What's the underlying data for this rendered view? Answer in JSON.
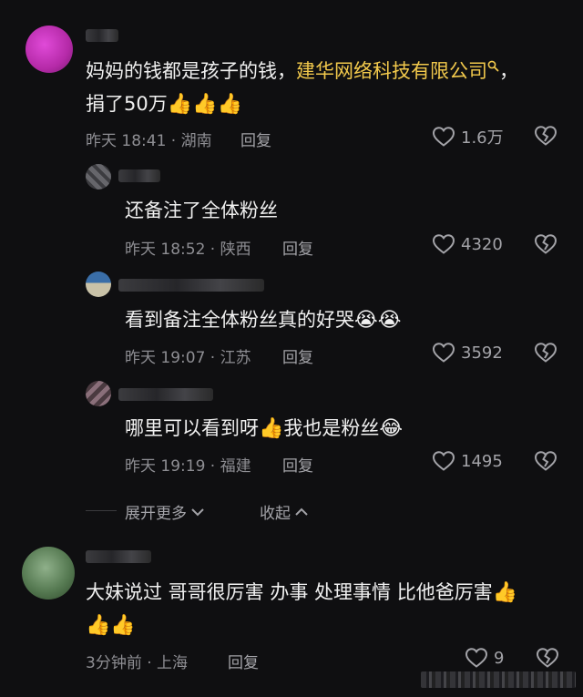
{
  "comments": [
    {
      "id": "c1",
      "text_line1": "妈妈的钱都是孩子的钱，",
      "link": "建华网络科技有限公司",
      "text_line1_tail": "，",
      "text_line2": "捐了50万",
      "emojis_line2": "👍👍👍",
      "meta": "昨天 18:41 · 湖南",
      "reply": "回复",
      "likes": "1.6万"
    },
    {
      "id": "r1",
      "text": "还备注了全体粉丝",
      "meta": "昨天 18:52 · 陕西",
      "reply": "回复",
      "likes": "4320"
    },
    {
      "id": "r2",
      "text": "看到备注全体粉丝真的好哭",
      "emoji": "😭😭",
      "meta": "昨天 19:07 · 江苏",
      "reply": "回复",
      "likes": "3592"
    },
    {
      "id": "r3",
      "text_a": "哪里可以看到呀",
      "emoji_a": "👍",
      "text_b": "我也是粉丝",
      "emoji_b": "😂",
      "meta": "昨天 19:19 · 福建",
      "reply": "回复",
      "likes": "1495"
    },
    {
      "id": "c2",
      "text_line1": "大妹说过 哥哥很厉害 办事 处理事情 比他爸厉害",
      "emoji_line1": "👍",
      "emojis_line2": "👍👍",
      "meta": "3分钟前 · 上海",
      "reply": "回复",
      "likes": "9"
    }
  ],
  "thread_controls": {
    "expand_more": "展开更多",
    "collapse": "收起"
  },
  "icons": {
    "heart": "heart-outline-icon",
    "dislike": "broken-heart-icon",
    "search": "search-icon",
    "chevron_down": "chevron-down-icon",
    "chevron_up": "chevron-up-icon"
  },
  "colors": {
    "background": "#0f0f11",
    "link": "#f2c94c",
    "meta": "#8e8e93"
  }
}
